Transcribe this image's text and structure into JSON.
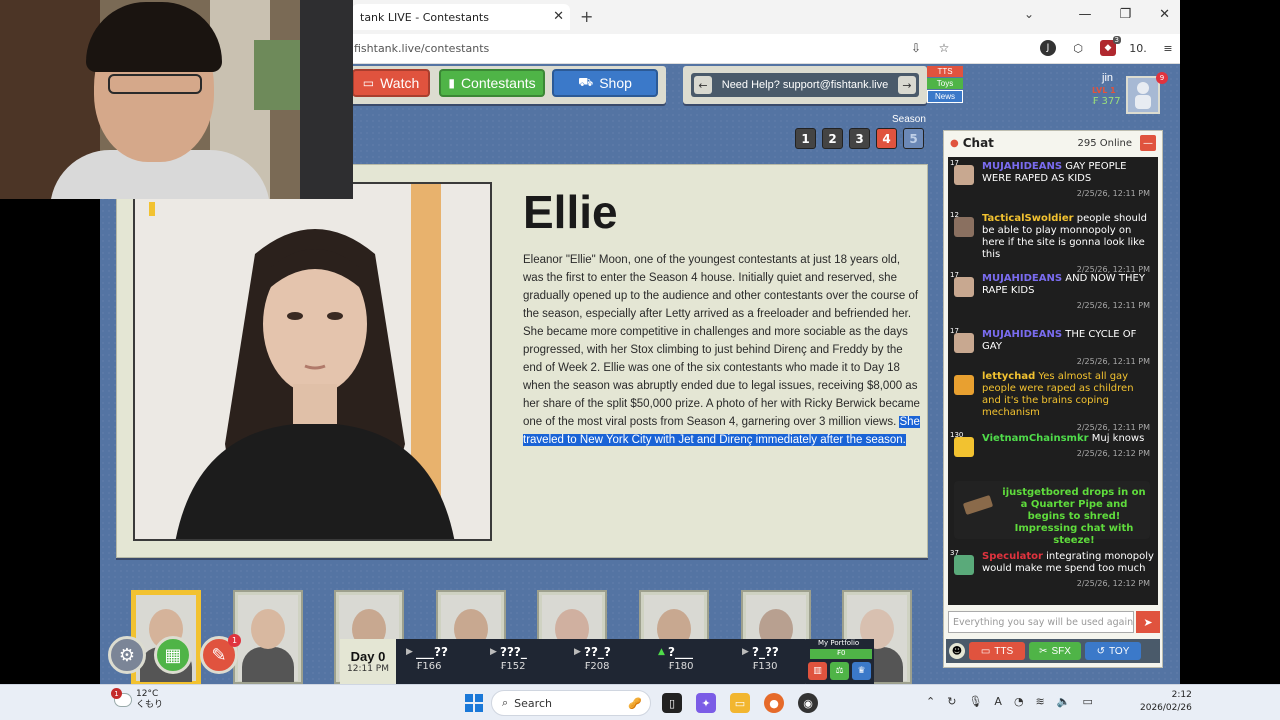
{
  "browser": {
    "tab_title": "tank LIVE - Contestants",
    "close_label": "✕",
    "new_tab_label": "+",
    "tab_list_label": "⌄",
    "window": {
      "minimize": "—",
      "restore": "❐",
      "close": "✕"
    },
    "url": "fishtank.live/contestants",
    "toolbar_right_text": "10."
  },
  "nav": {
    "watch": "Watch",
    "contestants": "Contestants",
    "shop": "Shop"
  },
  "help": {
    "text": "Need Help? support@fishtank.live",
    "prev": "←",
    "next": "→",
    "tags": [
      "TTS",
      "Toys",
      "News"
    ]
  },
  "user": {
    "name": "jin",
    "level": "LVL 1",
    "coins": "₣ 377",
    "notifications": "9"
  },
  "season": {
    "label": "Season",
    "options": [
      "1",
      "2",
      "3",
      "4",
      "5"
    ],
    "active": "4"
  },
  "profile": {
    "name": "Ellie",
    "bio": "Eleanor \"Ellie\" Moon, one of the youngest contestants at just 18 years old, was the first to enter the Season 4 house. Initially quiet and reserved, she gradually opened up to the audience and other contestants over the course of the season, especially after Letty arrived as a freeloader and befriended her. She became more competitive in challenges and more sociable as the days progressed, with her Stox climbing to just behind Direnç and Freddy by the end of Week 2. Ellie was one of the six contestants who made it to Day 18 when the season was abruptly ended due to legal issues, receiving $8,000 as her share of the split $50,000 prize. A photo of her with Ricky Berwick became one of the most viral posts from Season 4, garnering over 3 million views. ",
    "bio_highlight": "She traveled to New York City with Jet and Direnç immediately after the season."
  },
  "chat": {
    "title": "Chat",
    "online": "295 Online",
    "close": "—",
    "messages": [
      {
        "level": "17",
        "user": "MUJAHIDEANS",
        "text": " GAY PEOPLE WERE RAPED AS KIDS",
        "time": "2/25/26, 12:11 PM",
        "user_color": "#7a6cf0",
        "text_color": "#ffffff"
      },
      {
        "level": "12",
        "user": "TacticalSwoldier",
        "text": " people should be able to play monnopoly on here if the site is gonna look like this",
        "time": "2/25/26, 12:11 PM",
        "user_color": "#f2c230",
        "text_color": "#ffffff"
      },
      {
        "level": "17",
        "user": "MUJAHIDEANS",
        "text": " AND NOW THEY RAPE KIDS",
        "time": "2/25/26, 12:11 PM",
        "user_color": "#7a6cf0",
        "text_color": "#ffffff"
      },
      {
        "level": "17",
        "user": "MUJAHIDEANS",
        "text": " THE CYCLE OF GAY",
        "time": "2/25/26, 12:11 PM",
        "user_color": "#7a6cf0",
        "text_color": "#ffffff"
      },
      {
        "level": "",
        "user": "lettychad",
        "text": " Yes almost all gay people were raped as children and it's the brains coping mechanism",
        "time": "2/25/26, 12:11 PM",
        "user_color": "#f2c230",
        "text_color": "#f2c230"
      },
      {
        "level": "130",
        "user": "VietnamChainsmkr",
        "text": " Muj knows",
        "time": "2/25/26, 12:12 PM",
        "user_color": "#4fdc4a",
        "text_color": "#ffffff"
      },
      {
        "level": "37",
        "user": "Speculator",
        "text": " integrating monopoly would make me spend too much",
        "time": "2/25/26, 12:12 PM",
        "user_color": "#e0333e",
        "text_color": "#ffffff"
      }
    ],
    "system_message": "ijustgetbored drops in on a Quarter Pipe and begins to shred! Impressing chat with steeze!",
    "input_placeholder": "Everything you say will be used against",
    "send": "➤",
    "emoji": "☻",
    "buttons": [
      "TTS",
      "SFX",
      "TOY"
    ]
  },
  "contestant_count": 8,
  "hud": {
    "settings": "⚙",
    "green": "▦",
    "red": "✎",
    "red_badge": "1"
  },
  "stocks": {
    "day_label": "Day 0",
    "day_time": "12:11 PM",
    "items": [
      {
        "name": "___??",
        "price": "₣166",
        "arrow": "▶",
        "up": false
      },
      {
        "name": "???_",
        "price": "₣152",
        "arrow": "▶",
        "up": false
      },
      {
        "name": "??_?",
        "price": "₣208",
        "arrow": "▶",
        "up": false
      },
      {
        "name": "?___",
        "price": "₣180",
        "arrow": "▲",
        "up": true
      },
      {
        "name": "?_??",
        "price": "₣130",
        "arrow": "▶",
        "up": false
      }
    ],
    "portfolio_label": "My Portfolio",
    "portfolio_value": "₣0"
  },
  "taskbar": {
    "temp": "12°C",
    "weather_desc": "くもり",
    "weather_badge": "1",
    "search": "Search",
    "time": "2:12",
    "date": "2026/02/26"
  },
  "colors": {
    "site_bg": "#5474a3",
    "card_bg": "#e4e6d4",
    "red": "#e0533e",
    "green": "#4fb447",
    "blue": "#3b79c9",
    "highlight": "#1a63d6"
  }
}
